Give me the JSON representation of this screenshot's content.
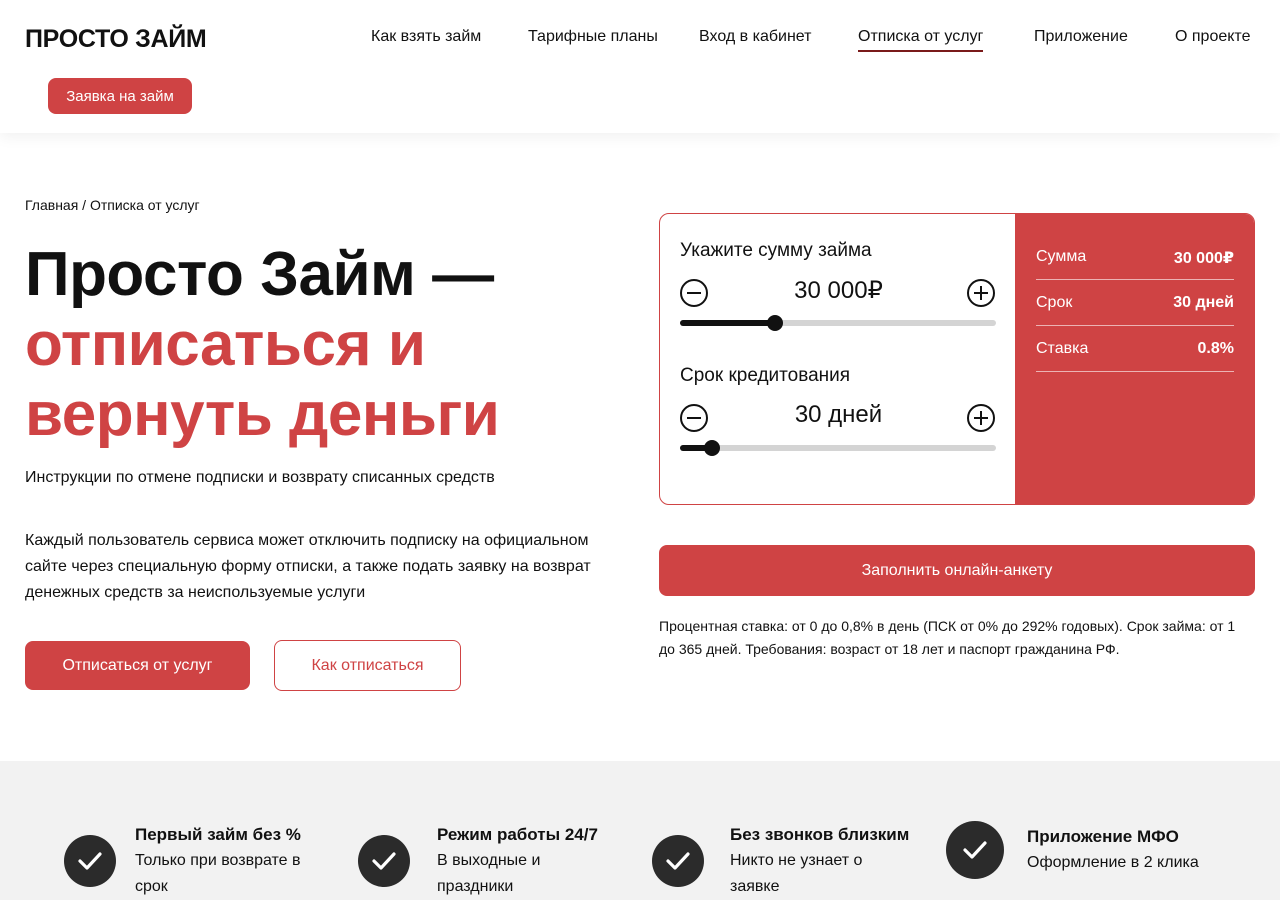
{
  "header": {
    "logo": "ПРОСТО ЗАЙМ",
    "nav": [
      {
        "label": "Как взять займ"
      },
      {
        "label": "Тарифные планы"
      },
      {
        "label": "Вход в кабинет"
      },
      {
        "label": "Отписка от услуг",
        "active": true
      },
      {
        "label": "Приложение"
      },
      {
        "label": "О проекте"
      }
    ],
    "apply_button": "Заявка на займ"
  },
  "hero": {
    "breadcrumb": "Главная / Отписка от услуг",
    "title_line1": "Просто Займ —",
    "title_line2": "отписаться и",
    "title_line3": "вернуть деньги",
    "subtitle": "Инструкции по отмене подписки и возврату списанных средств",
    "description": "Каждый пользователь сервиса может отключить подписку на официальном сайте через специальную форму отписки, а также подать заявку на возврат денежных средств за неиспользуемые услуги",
    "primary_button": "Отписаться от услуг",
    "secondary_button": "Как отписаться"
  },
  "calculator": {
    "amount_label": "Укажите сумму займа",
    "amount_value": "30 000₽",
    "amount_fraction": 0.3,
    "term_label": "Срок кредитования",
    "term_value": "30 дней",
    "term_fraction": 0.1,
    "summary": [
      {
        "key": "Сумма",
        "value": "30 000₽"
      },
      {
        "key": "Срок",
        "value": "30 дней"
      },
      {
        "key": "Ставка",
        "value": "0.8%"
      }
    ],
    "fill_button": "Заполнить онлайн-анкету",
    "terms": "Процентная ставка: от 0 до 0,8% в день (ПСК от 0% до 292% годовых). Срок займа: от 1 до 365 дней. Требования: возраст от 18 лет и паспорт гражданина РФ."
  },
  "features": [
    {
      "title": "Первый займ без %",
      "text": "Только при возврате в срок"
    },
    {
      "title": "Режим работы 24/7",
      "text": "В выходные и праздники"
    },
    {
      "title": "Без звонков близким",
      "text": "Никто не узнает о заявке"
    },
    {
      "title": "Приложение МФО",
      "text": "Оформление в 2 клика"
    }
  ],
  "colors": {
    "accent": "#cf4344",
    "dark": "#111111",
    "feature_bg": "#f2f2f2"
  }
}
